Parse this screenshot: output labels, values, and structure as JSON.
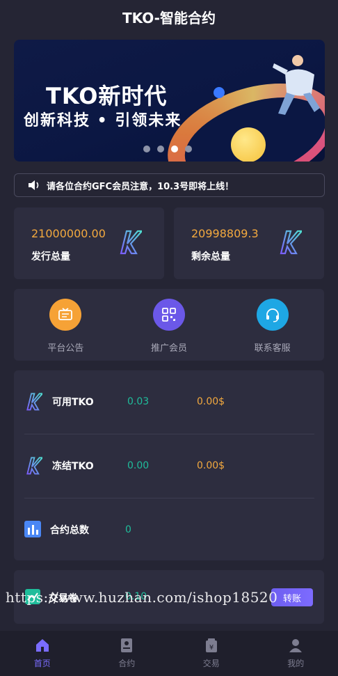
{
  "header": {
    "title": "TKO-智能合约"
  },
  "banner": {
    "headline": "TKO新时代",
    "subline": "创新科技 • 引领未来",
    "slide_count": 4,
    "active_slide": 3
  },
  "notice": {
    "text": "请各位合约GFC会员注意，10.3号即将上线！",
    "icon": "speaker-icon"
  },
  "stats": [
    {
      "value": "21000000.00",
      "label": "发行总量",
      "icon": "tko-k-logo-icon"
    },
    {
      "value": "20998809.3",
      "label": "剩余总量",
      "icon": "tko-k-logo-icon"
    }
  ],
  "quick_links": [
    {
      "label": "平台公告",
      "icon": "announcement-icon",
      "color": "#f6a236"
    },
    {
      "label": "推广会员",
      "icon": "qr-code-icon",
      "color": "#6b58e8"
    },
    {
      "label": "联系客服",
      "icon": "headset-icon",
      "color": "#1ea7e4"
    }
  ],
  "assets": [
    {
      "name": "可用TKO",
      "amount": "0.03",
      "usd": "0.00$",
      "icon": "tko-k-logo-icon"
    },
    {
      "name": "冻结TKO",
      "amount": "0.00",
      "usd": "0.00$",
      "icon": "tko-k-logo-icon"
    },
    {
      "name": "合约总数",
      "amount": "0",
      "usd": "",
      "icon": "bar-chart-icon"
    }
  ],
  "ticket": {
    "name": "交易卷",
    "amount": "0.10",
    "button": "转账",
    "icon": "chart-line-icon"
  },
  "watermark": "https://www.huzhan.com/ishop18520",
  "tabs": [
    {
      "label": "首页",
      "icon": "home-icon",
      "active": true
    },
    {
      "label": "合约",
      "icon": "contract-icon",
      "active": false
    },
    {
      "label": "交易",
      "icon": "trade-icon",
      "active": false
    },
    {
      "label": "我的",
      "icon": "user-icon",
      "active": false
    }
  ],
  "colors": {
    "accent": "#7a6cff",
    "gold": "#f3a93f",
    "green": "#1fbd9b",
    "bg": "#252534",
    "card": "#2d2d3f"
  }
}
